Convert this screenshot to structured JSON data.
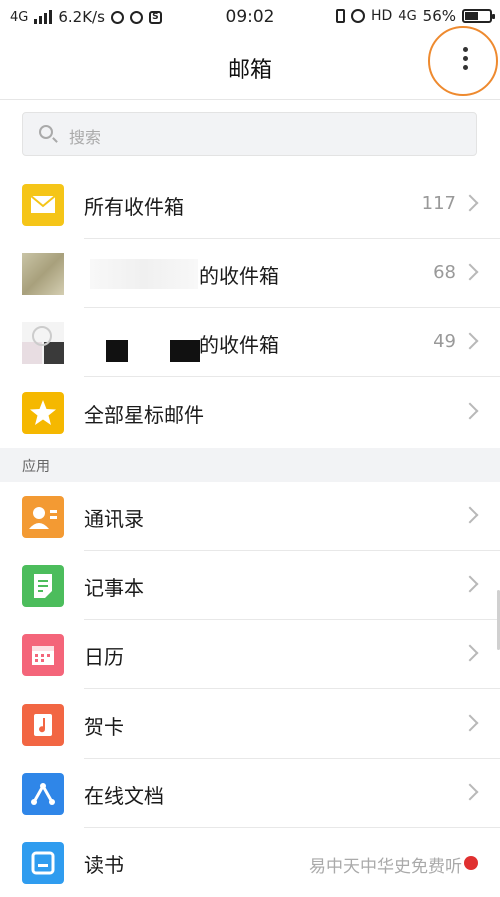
{
  "status_bar": {
    "network": "4G",
    "speed": "6.2K/s",
    "time": "09:02",
    "hd": "HD",
    "network_right": "4G",
    "battery": "56%",
    "battery_level": 0.56
  },
  "header": {
    "title": "邮箱"
  },
  "search": {
    "placeholder": "搜索"
  },
  "mailboxes": [
    {
      "label": "所有收件箱",
      "count": "117",
      "icon": "envelope-icon",
      "color": "#f5c518"
    },
    {
      "label": "的收件箱",
      "count": "68",
      "icon": "account-avatar",
      "color": "#b9b38e"
    },
    {
      "label": "的收件箱",
      "count": "49",
      "icon": "account-avatar",
      "color": "#dddddd"
    },
    {
      "label": "全部星标邮件",
      "count": "",
      "icon": "star-icon",
      "color": "#f5b800"
    }
  ],
  "apps_section": {
    "title": "应用",
    "items": [
      {
        "label": "通讯录",
        "icon": "contacts-icon",
        "color": "#f39a33"
      },
      {
        "label": "记事本",
        "icon": "notepad-icon",
        "color": "#4cbd5c"
      },
      {
        "label": "日历",
        "icon": "calendar-icon",
        "color": "#f4657a"
      },
      {
        "label": "贺卡",
        "icon": "greeting-card-icon",
        "color": "#f26643"
      },
      {
        "label": "在线文档",
        "icon": "online-docs-icon",
        "color": "#2f86e8"
      },
      {
        "label": "读书",
        "icon": "book-icon",
        "color": "#2f9cef"
      }
    ]
  },
  "watermark": "易中天中华史免费听"
}
